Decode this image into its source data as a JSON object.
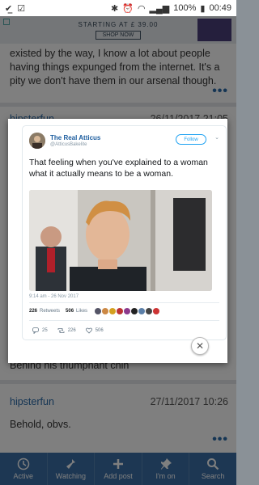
{
  "status_bar": {
    "battery": "100%",
    "time": "00:49"
  },
  "ad": {
    "text": "STARTING AT £ 39.00",
    "button": "SHOP NOW"
  },
  "background_posts": {
    "partial_text_lines": [
      "existed by the way, I know a lot about people",
      "having things expunged from the internet. It's a",
      "pity we don't have them in our arsenal though."
    ],
    "post2": {
      "author": "hipsterfun",
      "date": "26/11/2017 21:05"
    },
    "post2_tail": "Behind his triumphant chin",
    "post3": {
      "author": "hipsterfun",
      "date": "27/11/2017 10:26",
      "body": "Behold, obvs."
    },
    "more": "•••"
  },
  "tweet": {
    "name": "The Real Atticus",
    "handle": "@AtticusBakelite",
    "follow_label": "Follow",
    "text": "That feeling when you've explained to a woman what it actually means to be a woman.",
    "timestamp": "9:14 am - 26 Nov 2017",
    "retweets_count": "226",
    "retweets_label": "Retweets",
    "likes_count": "506",
    "likes_label": "Likes",
    "reply_count": "25",
    "retweet_action_count": "226",
    "like_action_count": "506"
  },
  "nav": [
    {
      "label": "Active",
      "icon": "clock-icon"
    },
    {
      "label": "Watching",
      "icon": "flashlight-icon"
    },
    {
      "label": "Add post",
      "icon": "plus-icon"
    },
    {
      "label": "I'm on",
      "icon": "pin-icon"
    },
    {
      "label": "Search",
      "icon": "search-icon"
    }
  ]
}
